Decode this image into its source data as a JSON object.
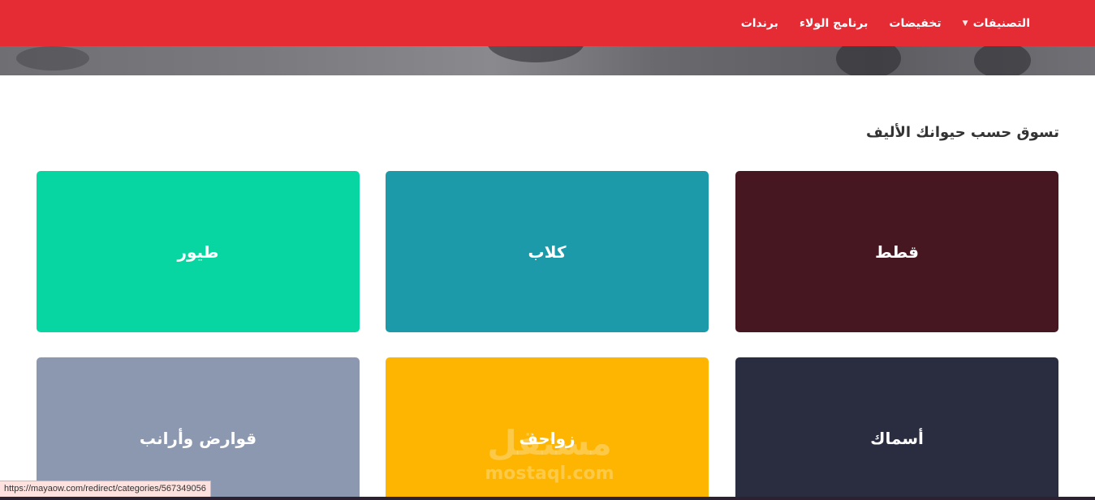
{
  "nav": {
    "items": [
      {
        "label": "التصنيفات",
        "has_dropdown": true
      },
      {
        "label": "تخفيضات"
      },
      {
        "label": "برنامج الولاء"
      },
      {
        "label": "برندات"
      }
    ]
  },
  "section": {
    "title": "تسوق حسب حيوانك الأليف"
  },
  "categories": [
    {
      "label": "قطط",
      "color": "#461621"
    },
    {
      "label": "كلاب",
      "color": "#1c9aa9"
    },
    {
      "label": "طيور",
      "color": "#07d6a2"
    },
    {
      "label": "أسماك",
      "color": "#2a2d40"
    },
    {
      "label": "زواحف",
      "color": "#fdb502"
    },
    {
      "label": "قوارض وأرانب",
      "color": "#8c98b0"
    }
  ],
  "watermark": {
    "arabic": "مستقل",
    "latin": "mostaql.com"
  },
  "status_bar": {
    "url": "https://mayaow.com/redirect/categories/567349056"
  },
  "colors": {
    "header": "#e52b34"
  }
}
